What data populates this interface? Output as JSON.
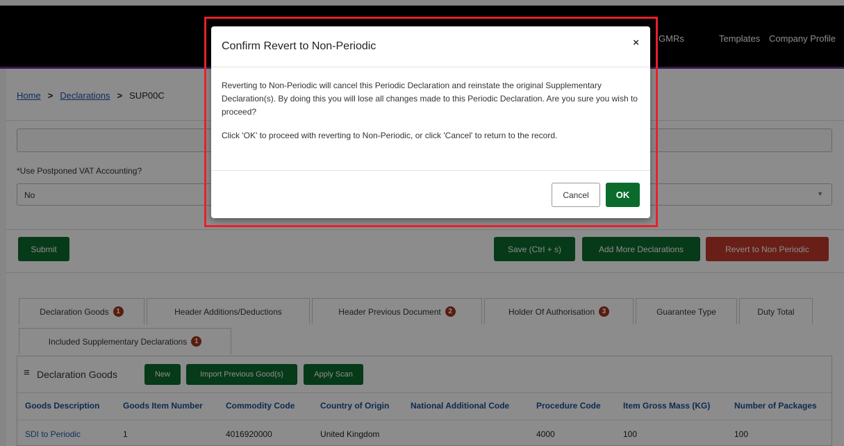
{
  "nav": {
    "gmrs": "GMRs",
    "templates": "Templates",
    "company_profile": "Company Profile"
  },
  "breadcrumb": {
    "home": "Home",
    "declarations": "Declarations",
    "current": "SUP00C"
  },
  "form": {
    "pva_label": "Use Postponed VAT Accounting?",
    "pva_value": "No",
    "required_mark": "*"
  },
  "actions": {
    "submit": "Submit",
    "save": "Save (Ctrl + s)",
    "add_more": "Add More Declarations",
    "revert": "Revert to Non Periodic"
  },
  "tabs": [
    {
      "label": "Declaration Goods",
      "badge": "1"
    },
    {
      "label": "Header Additions/Deductions",
      "badge": ""
    },
    {
      "label": "Header Previous Document",
      "badge": "2"
    },
    {
      "label": "Holder Of Authorisation",
      "badge": "3"
    },
    {
      "label": "Guarantee Type",
      "badge": ""
    },
    {
      "label": "Duty Total",
      "badge": ""
    },
    {
      "label": "Included Supplementary Declarations",
      "badge": "1"
    }
  ],
  "goods_panel": {
    "title": "Declaration Goods",
    "new": "New",
    "import_previous": "Import Previous Good(s)",
    "apply_scan": "Apply Scan"
  },
  "table": {
    "headers": [
      "Goods Description",
      "Goods Item Number",
      "Commodity Code",
      "Country of Origin",
      "National Additional Code",
      "Procedure Code",
      "Item Gross Mass (KG)",
      "Number of Packages"
    ],
    "rows": [
      [
        "SDI to Periodic",
        "1",
        "4016920000",
        "United Kingdom",
        "",
        "4000",
        "100",
        "100"
      ]
    ]
  },
  "modal": {
    "title": "Confirm Revert to Non-Periodic",
    "close": "×",
    "body_1": "Reverting to Non-Periodic will cancel this Periodic Declaration and reinstate the original Supplementary Declaration(s). By doing this you will lose all changes made to this Periodic Declaration. Are you sure you wish to proceed?",
    "body_2": "Click 'OK' to proceed with reverting to Non-Periodic, or click 'Cancel' to return to the record.",
    "cancel": "Cancel",
    "ok": "OK"
  },
  "colors": {
    "accent_green": "#0b6b2d",
    "danger_red": "#c0392b",
    "header_purple": "#6a2c91",
    "highlight_red": "#e8202a"
  }
}
